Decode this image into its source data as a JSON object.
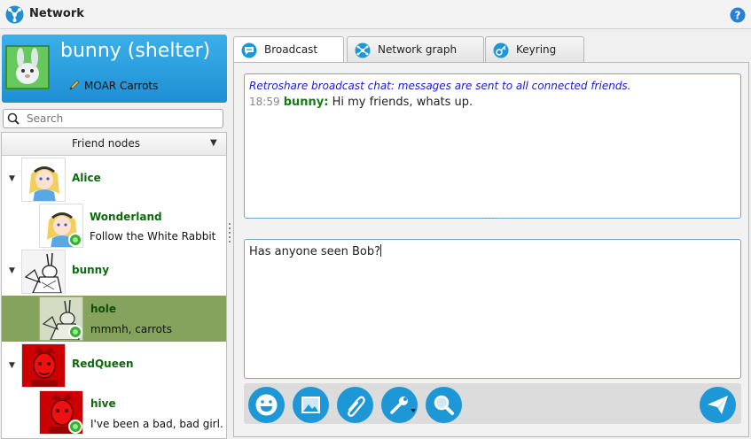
{
  "window": {
    "title": "Network"
  },
  "profile": {
    "name": "bunny (shelter)",
    "status": "MOAR Carrots"
  },
  "search": {
    "placeholder": "Search"
  },
  "friends": {
    "header": "Friend nodes",
    "nodes": [
      {
        "name": "Alice",
        "status": ""
      },
      {
        "name": "Wonderland",
        "status": "Follow the White Rabbit"
      },
      {
        "name": "bunny",
        "status": ""
      },
      {
        "name": "hole",
        "status": "mmmh, carrots"
      },
      {
        "name": "RedQueen",
        "status": ""
      },
      {
        "name": "hive",
        "status": "I've been a bad, bad girl."
      }
    ]
  },
  "tabs": [
    {
      "label": "Broadcast",
      "active": true
    },
    {
      "label": "Network graph",
      "active": false
    },
    {
      "label": "Keyring",
      "active": false
    }
  ],
  "chat": {
    "info": "Retroshare broadcast chat: messages are sent to all connected friends.",
    "messages": [
      {
        "time": "18:59",
        "sender": "bunny:",
        "text": "Hi my friends, whats up."
      }
    ]
  },
  "compose": {
    "text": "Has anyone seen Bob?"
  },
  "toolbar": {
    "buttons": [
      "emoticon-icon",
      "image-icon",
      "attach-icon",
      "tools-icon",
      "search-icon"
    ],
    "send": "send-icon"
  },
  "colors": {
    "accent": "#1e97d6",
    "selected_row": "#86a35e",
    "friend_name": "#0b6a0b",
    "info_text": "#1a1ad0"
  }
}
